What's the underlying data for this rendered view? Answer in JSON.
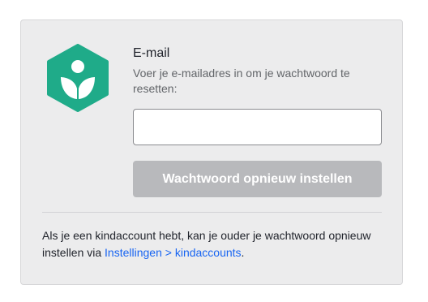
{
  "colors": {
    "brand": "#1fab89",
    "link": "#1865f2",
    "button_disabled": "#b8b9bc",
    "panel": "#ececed"
  },
  "logo": {
    "icon": "khan-academy-logo-icon"
  },
  "form": {
    "label": "E-mail",
    "description": "Voer je e-mailadres in om je wachtwoord te resetten:",
    "email_value": "",
    "email_placeholder": "",
    "submit_label": "Wachtwoord opnieuw instellen"
  },
  "footer": {
    "text_before": "Als je een kindaccount hebt, kan je ouder je wachtwoord opnieuw instellen via ",
    "link_text": "Instellingen > kindaccounts",
    "text_after": "."
  }
}
